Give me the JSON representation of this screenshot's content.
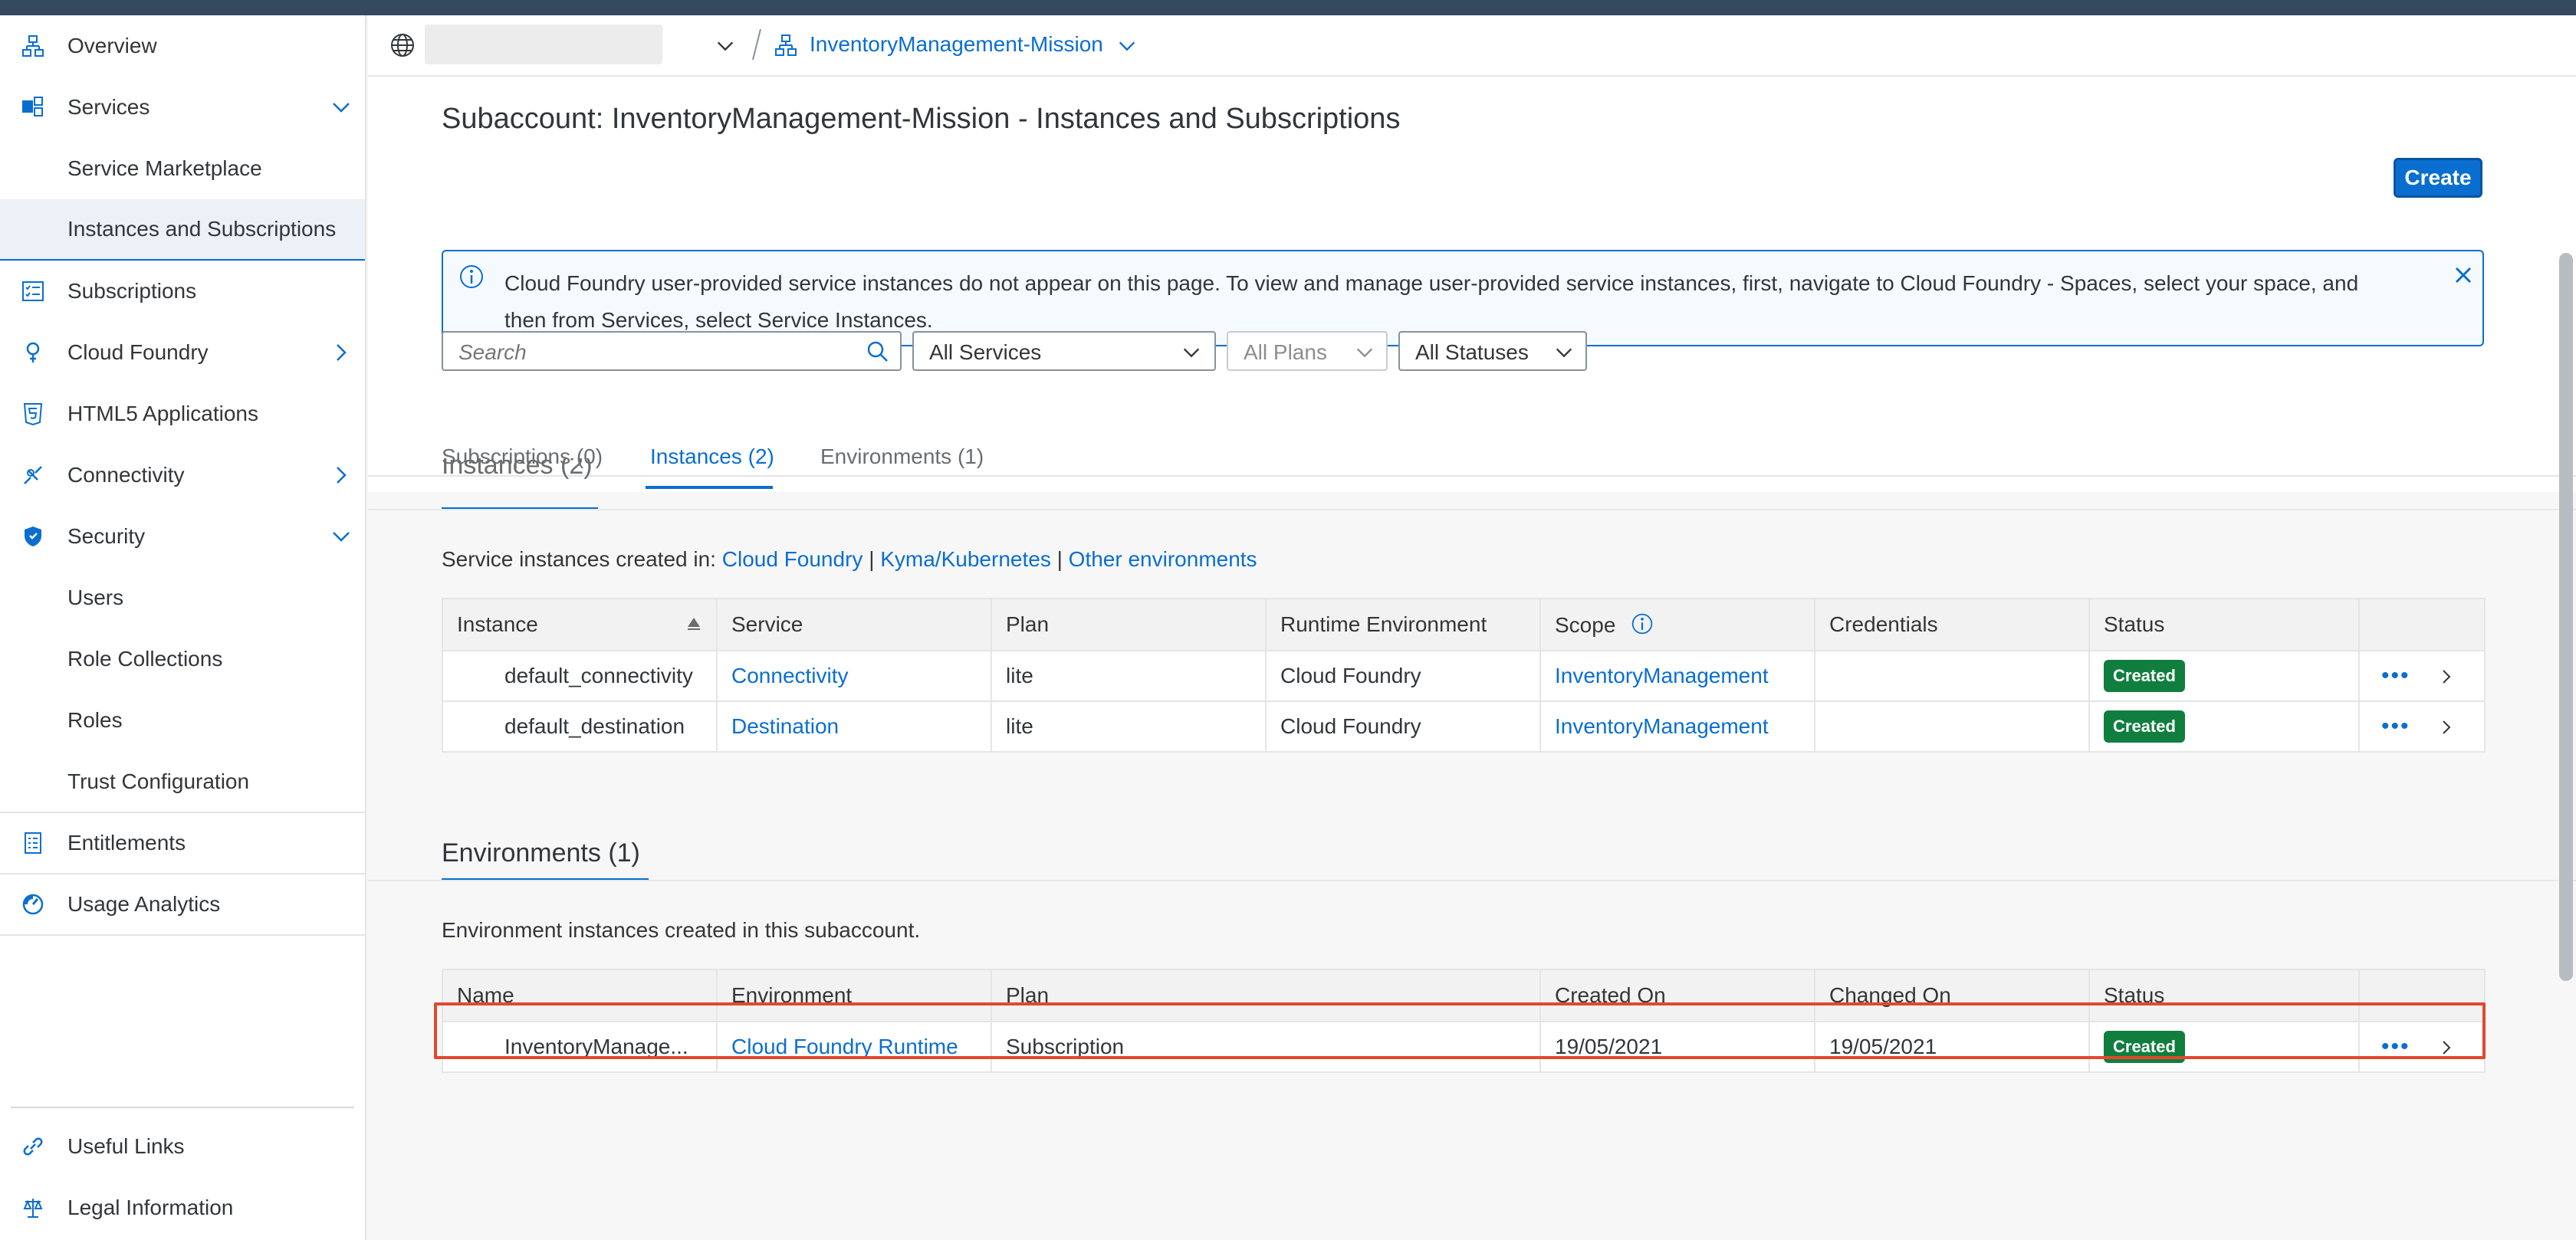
{
  "sidebar": {
    "items": [
      {
        "label": "Overview"
      },
      {
        "label": "Services"
      },
      {
        "label": "Service Marketplace"
      },
      {
        "label": "Instances and Subscriptions"
      },
      {
        "label": "Subscriptions"
      },
      {
        "label": "Cloud Foundry"
      },
      {
        "label": "HTML5 Applications"
      },
      {
        "label": "Connectivity"
      },
      {
        "label": "Security"
      },
      {
        "label": "Users"
      },
      {
        "label": "Role Collections"
      },
      {
        "label": "Roles"
      },
      {
        "label": "Trust Configuration"
      },
      {
        "label": "Entitlements"
      },
      {
        "label": "Usage Analytics"
      },
      {
        "label": "Useful Links"
      },
      {
        "label": "Legal Information"
      }
    ]
  },
  "breadcrumb": {
    "subaccount": "InventoryManagement-Mission"
  },
  "page": {
    "title": "Subaccount: InventoryManagement-Mission - Instances and Subscriptions",
    "create_label": "Create"
  },
  "info": {
    "message": "Cloud Foundry user-provided service instances do not appear on this page. To view and manage user-provided service instances, first, navigate to Cloud Foundry - Spaces, select your space, and then from Services, select Service Instances."
  },
  "filters": {
    "search_placeholder": "Search",
    "services": "All Services",
    "plans": "All Plans",
    "statuses": "All Statuses"
  },
  "tabs": [
    {
      "label": "Subscriptions (0)"
    },
    {
      "label": "Instances (2)"
    },
    {
      "label": "Environments (1)"
    }
  ],
  "instances": {
    "partial_title": "Instances (2)",
    "created_in_label": "Service instances created in:",
    "links": [
      "Cloud Foundry",
      "Kyma/Kubernetes",
      "Other environments"
    ],
    "separator": "|",
    "columns": [
      "Instance",
      "Service",
      "Plan",
      "Runtime Environment",
      "Scope",
      "Credentials",
      "Status"
    ],
    "rows": [
      {
        "instance": "default_connectivity",
        "service": "Connectivity",
        "plan": "lite",
        "runtime": "Cloud Foundry",
        "scope": "InventoryManagement",
        "credentials": "",
        "status": "Created"
      },
      {
        "instance": "default_destination",
        "service": "Destination",
        "plan": "lite",
        "runtime": "Cloud Foundry",
        "scope": "InventoryManagement",
        "credentials": "",
        "status": "Created"
      }
    ]
  },
  "environments": {
    "title": "Environments (1)",
    "description": "Environment instances created in this subaccount.",
    "columns": [
      "Name",
      "Environment",
      "Plan",
      "Created On",
      "Changed On",
      "Status"
    ],
    "rows": [
      {
        "name": "InventoryManage...",
        "environment": "Cloud Foundry Runtime",
        "plan": "Subscription",
        "created_on": "19/05/2021",
        "changed_on": "19/05/2021",
        "status": "Created"
      }
    ]
  },
  "colors": {
    "accent": "#0a6ed1",
    "status_created": "#107e3e",
    "highlight": "#e2482d",
    "shell": "#354a5f"
  },
  "icons": [
    "hierarchy-icon",
    "services-icon",
    "subscriptions-icon",
    "cloud-foundry-icon",
    "html5-icon",
    "connectivity-icon",
    "security-shield-icon",
    "entitlements-icon",
    "usage-analytics-icon",
    "link-icon",
    "legal-scale-icon",
    "globe-icon",
    "info-icon",
    "close-icon",
    "search-icon",
    "chevron-down-icon",
    "chevron-right-icon",
    "sort-icon",
    "more-options-icon"
  ]
}
